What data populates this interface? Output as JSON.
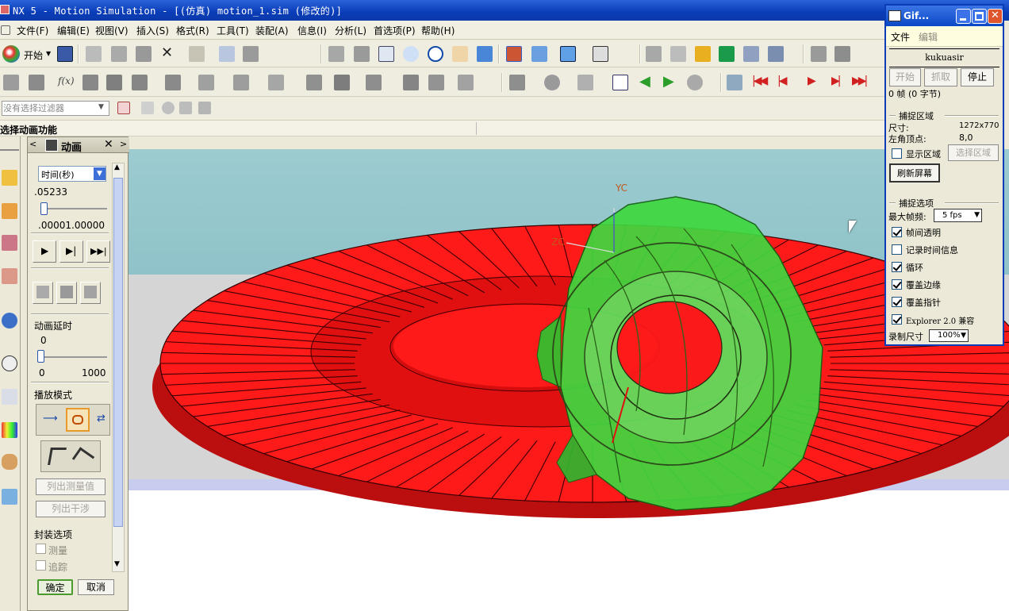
{
  "window": {
    "title": "NX 5 - Motion Simulation - [(仿真) motion_1.sim (修改的)]"
  },
  "menu": [
    "文件(F)",
    "编辑(E)",
    "视图(V)",
    "插入(S)",
    "格式(R)",
    "工具(T)",
    "装配(A)",
    "信息(I)",
    "分析(L)",
    "首选项(P)",
    "帮助(H)"
  ],
  "toolbar": {
    "start_label": "开始"
  },
  "filter": {
    "placeholder": "没有选择过滤器"
  },
  "status": {
    "prompt": "选择动画功能"
  },
  "panel": {
    "title": "动画",
    "time_unit": "时间(秒)",
    "time_value": ".05233",
    "time_min": ".00001",
    "time_max": ".00000",
    "time_slider_fraction": 0.05,
    "delay_label": "动画延时",
    "delay_value": "0",
    "delay_min": "0",
    "delay_max": "1000",
    "delay_slider_fraction": 0.0,
    "playmode_label": "播放模式",
    "list_measure_label": "列出测量值",
    "list_interference_label": "列出干涉",
    "package_label": "封装选项",
    "measure_label": "测量",
    "trace_label": "追踪",
    "ok_label": "确定",
    "cancel_label": "取消"
  },
  "viewport": {
    "axis_yc": "YC",
    "axis_zc": "ZC",
    "bg_top": "#9bcbd0",
    "bg_floor": "#d5d5d5",
    "gear_red": "#ff1a1a",
    "gear_green": "#3fd83f"
  },
  "gif_tool": {
    "title": "Gif...",
    "menu_file": "文件",
    "menu_edit": "编辑",
    "name": "kukuasir",
    "btn_start": "开始",
    "btn_capture": "抓取",
    "btn_stop": "停止",
    "frame_info": "0 帧 (0 字节)",
    "capture_area_title": "捕捉区域",
    "size_label": "尺寸:",
    "size_value": "1272x770",
    "origin_label": "左角顶点:",
    "origin_value": "8,0",
    "show_area_label": "显示区域",
    "select_area_btn": "选择区域",
    "refresh_btn": "刷新屏幕",
    "options_title": "捕捉选项",
    "max_fps_label": "最大帧频:",
    "max_fps_value": "5 fps",
    "opt_transparent": "帧间透明",
    "opt_timeinfo": "记录时间信息",
    "opt_loop": "循环",
    "opt_edge": "覆盖边缘",
    "opt_pointer": "覆盖指针",
    "opt_explorer": "Explorer 2.0 兼容",
    "record_size_label": "录制尺寸",
    "record_size_value": "100%"
  }
}
